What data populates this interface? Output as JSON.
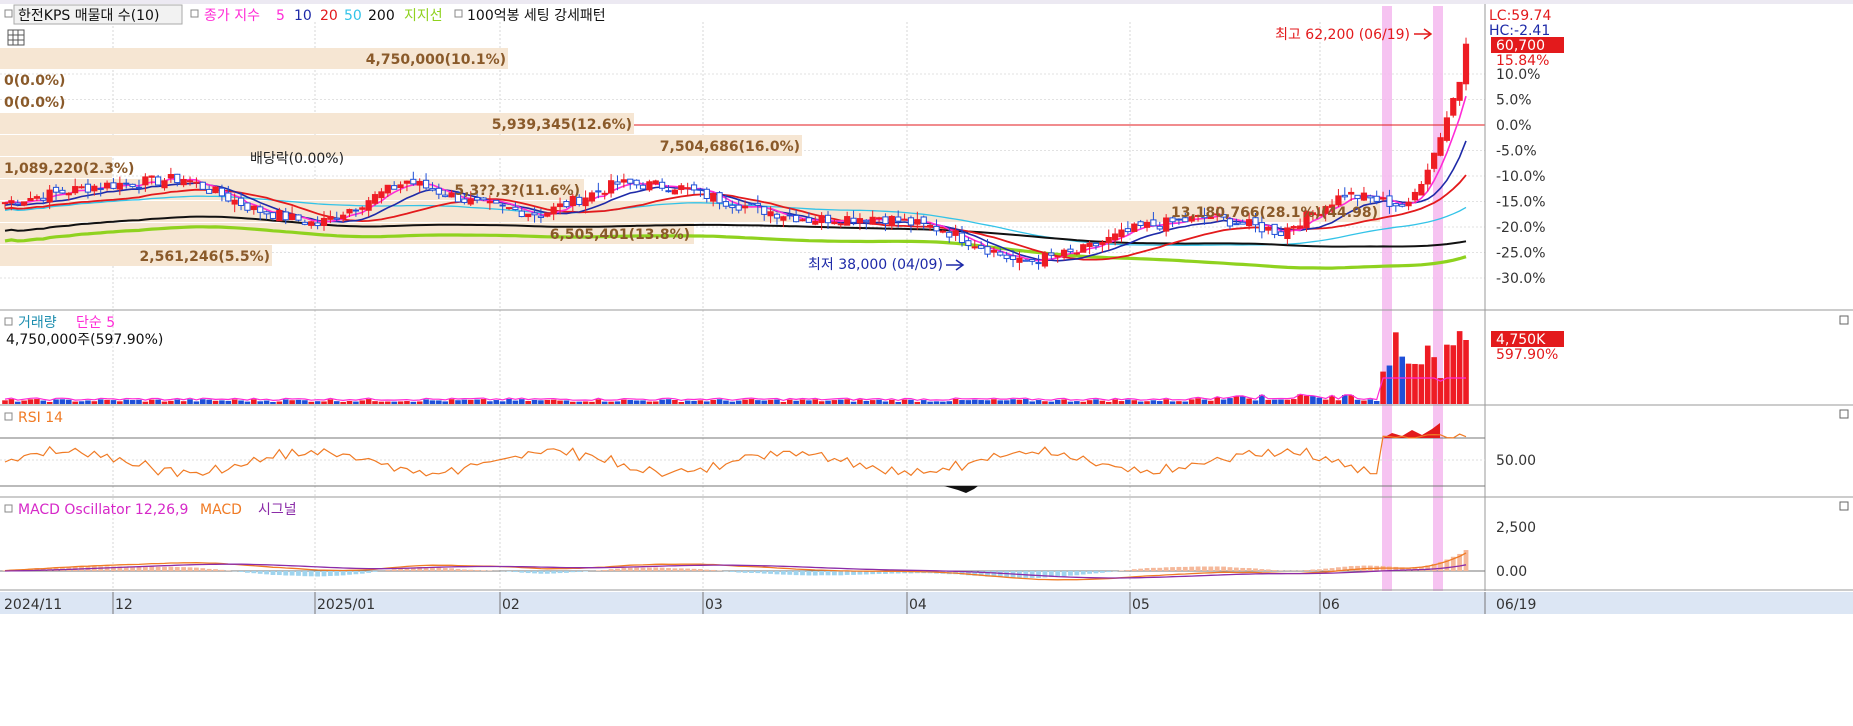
{
  "header": {
    "stock_name": "한전KPS 매물대 수(10)",
    "ma_label": "종가 지수",
    "ma_periods": [
      "5",
      "10",
      "20",
      "50",
      "200"
    ],
    "support_label": "지지선",
    "pattern_label": "100억봉 세팅 강세패턴"
  },
  "right_axis": {
    "lc_label": "LC:59.74",
    "hc_label": "HC:-2.41",
    "current_price": "60,700",
    "current_pct": "15.84%",
    "pct_ticks": [
      "10.0%",
      "5.0%",
      "0.0%",
      "-5.0%",
      "-10.0%",
      "-15.0%",
      "-20.0%",
      "-25.0%",
      "-30.0%"
    ]
  },
  "volume_profile": [
    {
      "label": "4,750,000(10.1%)"
    },
    {
      "label": "0(0.0%)"
    },
    {
      "label": "0(0.0%)"
    },
    {
      "label": "5,939,345(12.6%)"
    },
    {
      "label": "7,504,686(16.0%)"
    },
    {
      "label": "1,089,220(2.3%)"
    },
    {
      "label": "5,3??,3?(11.6%)"
    },
    {
      "label": "13,180,766(28.1%)(44.98)"
    },
    {
      "label": "6,505,401(13.8%)"
    },
    {
      "label": "2,561,246(5.5%)"
    }
  ],
  "annotations": {
    "high": "최고 62,200 (06/19)",
    "low": "최저 38,000 (04/09)",
    "dividend": "배당락(0.00%)"
  },
  "volume_panel": {
    "title": "거래량",
    "ma_label": "단순 5",
    "info": "4,750,000주(597.90%)",
    "current": "4,750K",
    "current_pct": "597.90%"
  },
  "rsi_panel": {
    "title": "RSI 14",
    "tick": "50.00"
  },
  "macd_panel": {
    "title": "MACD Oscillator 12,26,9",
    "macd_label": "MACD",
    "signal_label": "시그널",
    "ticks": [
      "2,500",
      "0.00"
    ]
  },
  "x_axis": {
    "labels": [
      "2024/11",
      "12",
      "2025/01",
      "02",
      "03",
      "04",
      "05",
      "06",
      "06/19"
    ]
  },
  "colors": {
    "up": "#ee1c24",
    "down": "#1f4fd8",
    "ma5": "#ff2bd6",
    "ma10": "#1e2aa8",
    "ma20": "#e31a1c",
    "ma50": "#33c3e8",
    "ma200": "#000000",
    "support": "#8fd21f",
    "profile": "#f6e6d3",
    "rsi": "#f07b25",
    "macd": "#f07b25",
    "signal": "#8b2ca8"
  },
  "chart_data": [
    {
      "type": "candlestick",
      "title": "한전KPS",
      "period": {
        "start": "2024/11",
        "end": "06/19"
      },
      "high": {
        "date": "06/19",
        "value": 62200
      },
      "low": {
        "date": "04/09",
        "value": 38000
      },
      "close": 60700,
      "close_change_pct": 15.84,
      "price_levels_pct": [
        {
          "date": "2024-11-01",
          "close_pct": -15.2
        },
        {
          "date": "2024-11-15",
          "close_pct": -12.0
        },
        {
          "date": "2024-11-29",
          "close_pct": -10.5
        },
        {
          "date": "2024-12-10",
          "close_pct": -16.5
        },
        {
          "date": "2024-12-20",
          "close_pct": -19.5
        },
        {
          "date": "2025-01-03",
          "close_pct": -11.0
        },
        {
          "date": "2025-01-14",
          "close_pct": -15.5
        },
        {
          "date": "2025-01-24",
          "close_pct": -17.5
        },
        {
          "date": "2025-02-05",
          "close_pct": -11.5
        },
        {
          "date": "2025-02-14",
          "close_pct": -12.0
        },
        {
          "date": "2025-02-25",
          "close_pct": -16.0
        },
        {
          "date": "2025-03-07",
          "close_pct": -18.5
        },
        {
          "date": "2025-03-18",
          "close_pct": -18.0
        },
        {
          "date": "2025-03-28",
          "close_pct": -20.5
        },
        {
          "date": "2025-04-09",
          "close_pct": -27.0
        },
        {
          "date": "2025-04-18",
          "close_pct": -25.0
        },
        {
          "date": "2025-04-28",
          "close_pct": -20.0
        },
        {
          "date": "2025-05-09",
          "close_pct": -18.0
        },
        {
          "date": "2025-05-20",
          "close_pct": -21.0
        },
        {
          "date": "2025-05-30",
          "close_pct": -13.5
        },
        {
          "date": "2025-06-09",
          "close_pct": -16.0
        },
        {
          "date": "2025-06-13",
          "close_pct": -5.5
        },
        {
          "date": "2025-06-19",
          "close_pct": 15.84
        }
      ],
      "volume_profile_pct": [
        10.1,
        0.0,
        0.0,
        12.6,
        16.0,
        2.3,
        11.6,
        28.1,
        13.8,
        5.5
      ]
    },
    {
      "type": "bar",
      "title": "거래량",
      "latest_volume": 4750000,
      "latest_ratio_pct": 597.9
    },
    {
      "type": "line",
      "title": "RSI 14",
      "yticks": [
        50.0
      ]
    },
    {
      "type": "bar",
      "title": "MACD Oscillator 12,26,9",
      "yticks": [
        0.0,
        2500
      ]
    }
  ]
}
